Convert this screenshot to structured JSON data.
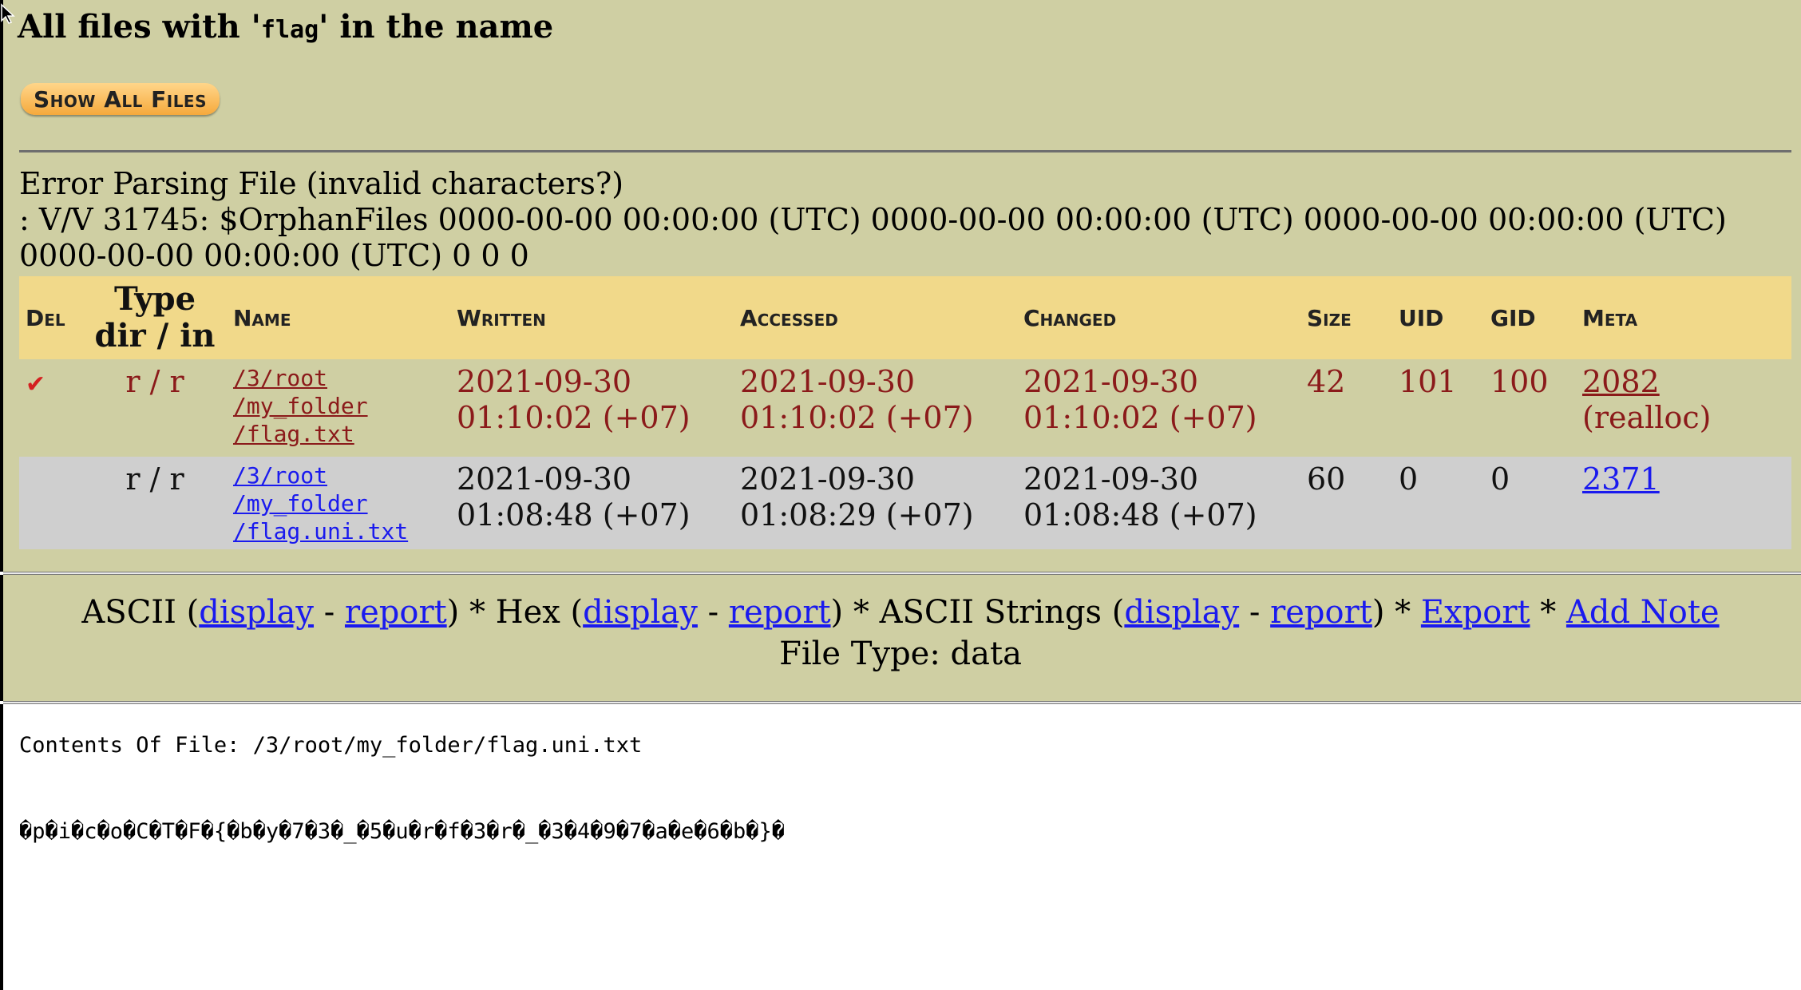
{
  "header": {
    "title_prefix": "All files with '",
    "title_term": "flag",
    "title_suffix": "' in the name",
    "show_all_button": "Show All Files"
  },
  "error": {
    "line1": "Error Parsing File (invalid characters?)",
    "line2": ": V/V 31745: $OrphanFiles 0000-00-00 00:00:00 (UTC) 0000-00-00 00:00:00 (UTC) 0000-00-00 00:00:00 (UTC) 0000-00-00 00:00:00 (UTC) 0 0 0"
  },
  "table": {
    "headers": {
      "del": "Del",
      "type_line1": "Type",
      "type_line2": "dir / in",
      "name": "Name",
      "written": "Written",
      "accessed": "Accessed",
      "changed": "Changed",
      "size": "Size",
      "uid": "UID",
      "gid": "GID",
      "meta": "Meta"
    },
    "rows": [
      {
        "deleted_mark": "✔",
        "type": "r / r",
        "path1": "/3/root",
        "path2": "/my_folder",
        "path3": "/flag.txt",
        "written_date": "2021-09-30",
        "written_time": "01:10:02 (+07)",
        "accessed_date": "2021-09-30",
        "accessed_time": "01:10:02 (+07)",
        "changed_date": "2021-09-30",
        "changed_time": "01:10:02 (+07)",
        "size": "42",
        "uid": "101",
        "gid": "100",
        "meta": "2082",
        "meta_note": "(realloc)"
      },
      {
        "deleted_mark": "",
        "type": "r / r",
        "path1": "/3/root",
        "path2": "/my_folder",
        "path3": "/flag.uni.txt",
        "written_date": "2021-09-30",
        "written_time": "01:08:48 (+07)",
        "accessed_date": "2021-09-30",
        "accessed_time": "01:08:29 (+07)",
        "changed_date": "2021-09-30",
        "changed_time": "01:08:48 (+07)",
        "size": "60",
        "uid": "0",
        "gid": "0",
        "meta": "2371",
        "meta_note": ""
      }
    ]
  },
  "actions": {
    "ascii": "ASCII (",
    "hex": ") * Hex (",
    "ascii_strings": ") * ASCII Strings (",
    "close_star": ") * ",
    "star": " * ",
    "dash": " - ",
    "display": "display",
    "report": "report",
    "export": "Export",
    "add_note": "Add Note",
    "file_type": "File Type: data"
  },
  "contents": {
    "header": "Contents Of File: /3/root/my_folder/flag.uni.txt",
    "body": "�p�i�c�o�C�T�F�{�b�y�7�3�_�5�u�r�f�3�r�_�3�4�9�7�a�e�6�b�}�"
  },
  "colors": {
    "panel_bg": "#cfcfa3",
    "header_bg": "#f1d98a",
    "alt_row_bg": "#cfcfcf",
    "deleted_text": "#8b1a1a",
    "link": "#1a1aee",
    "button_gradient_top": "#ffd68a",
    "button_gradient_bottom": "#f6a93c"
  },
  "icons": {
    "cursor": "mouse-pointer-icon",
    "deleted": "checkmark-icon"
  }
}
